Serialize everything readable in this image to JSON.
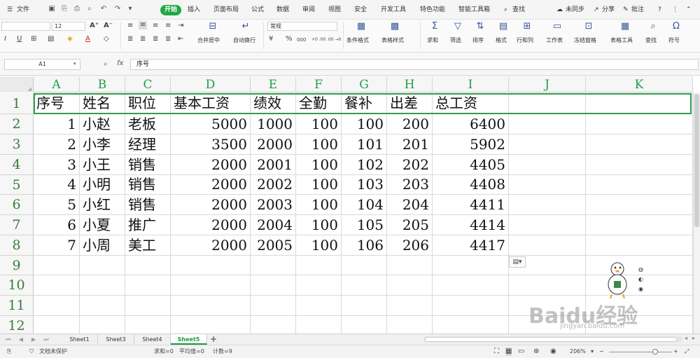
{
  "menu": {
    "file": "文件",
    "tabs": [
      "开始",
      "插入",
      "页面布局",
      "公式",
      "数据",
      "审阅",
      "视图",
      "安全",
      "开发工具",
      "特色功能",
      "智能工具箱"
    ],
    "search": "查找",
    "sync": "未同步",
    "share": "分享",
    "comment": "批注",
    "help": "?"
  },
  "ribbon": {
    "font_size": "12",
    "font_grow": "A⁺",
    "font_shrink": "A⁻",
    "merge": "合并居中",
    "wrap": "自动换行",
    "number_format": "常规",
    "percent": "%",
    "thousands": "000",
    "dec_inc": "+0 .00",
    "dec_dec": ".00 →0",
    "cond_format": "条件格式",
    "table_style": "表格样式",
    "sum": "求和",
    "filter": "筛选",
    "sort": "排序",
    "format": "格式",
    "rows_cols": "行和列",
    "worksheet": "工作表",
    "freeze": "冻结窗格",
    "table_tools": "表格工具",
    "find": "查找",
    "symbol": "符号"
  },
  "formula_bar": {
    "cell_ref": "A1",
    "fx": "fx",
    "content": "序号"
  },
  "grid": {
    "columns": [
      "A",
      "B",
      "C",
      "D",
      "E",
      "F",
      "G",
      "H",
      "I",
      "J",
      "K"
    ],
    "rows": [
      "1",
      "2",
      "3",
      "4",
      "5",
      "6",
      "7",
      "8",
      "9",
      "10",
      "11",
      "12"
    ],
    "data": [
      [
        "序号",
        "姓名",
        "职位",
        "基本工资",
        "绩效",
        "全勤",
        "餐补",
        "出差",
        "总工资"
      ],
      [
        "1",
        "小赵",
        "老板",
        "5000",
        "1000",
        "100",
        "100",
        "200",
        "6400"
      ],
      [
        "2",
        "小李",
        "经理",
        "3500",
        "2000",
        "100",
        "101",
        "201",
        "5902"
      ],
      [
        "3",
        "小王",
        "销售",
        "2000",
        "2001",
        "100",
        "102",
        "202",
        "4405"
      ],
      [
        "4",
        "小明",
        "销售",
        "2000",
        "2002",
        "100",
        "103",
        "203",
        "4408"
      ],
      [
        "5",
        "小红",
        "销售",
        "2000",
        "2003",
        "100",
        "104",
        "204",
        "4411"
      ],
      [
        "6",
        "小夏",
        "推广",
        "2000",
        "2004",
        "100",
        "105",
        "205",
        "4414"
      ],
      [
        "7",
        "小周",
        "美工",
        "2000",
        "2005",
        "100",
        "106",
        "206",
        "4417"
      ]
    ]
  },
  "sheets": [
    "Sheet1",
    "Sheet3",
    "Sheet4",
    "Sheet5"
  ],
  "active_sheet": "Sheet5",
  "add_sheet": "+",
  "status": {
    "protect": "文档未保护",
    "sum": "求和=0",
    "avg": "平均值=0",
    "count": "计数=9",
    "zoom": "206%"
  },
  "watermark": {
    "brand": "Baidu经验",
    "url": "jingyan.baidu.com"
  },
  "colors": {
    "accent": "#1fa843",
    "header_text": "#1e9f4a"
  }
}
